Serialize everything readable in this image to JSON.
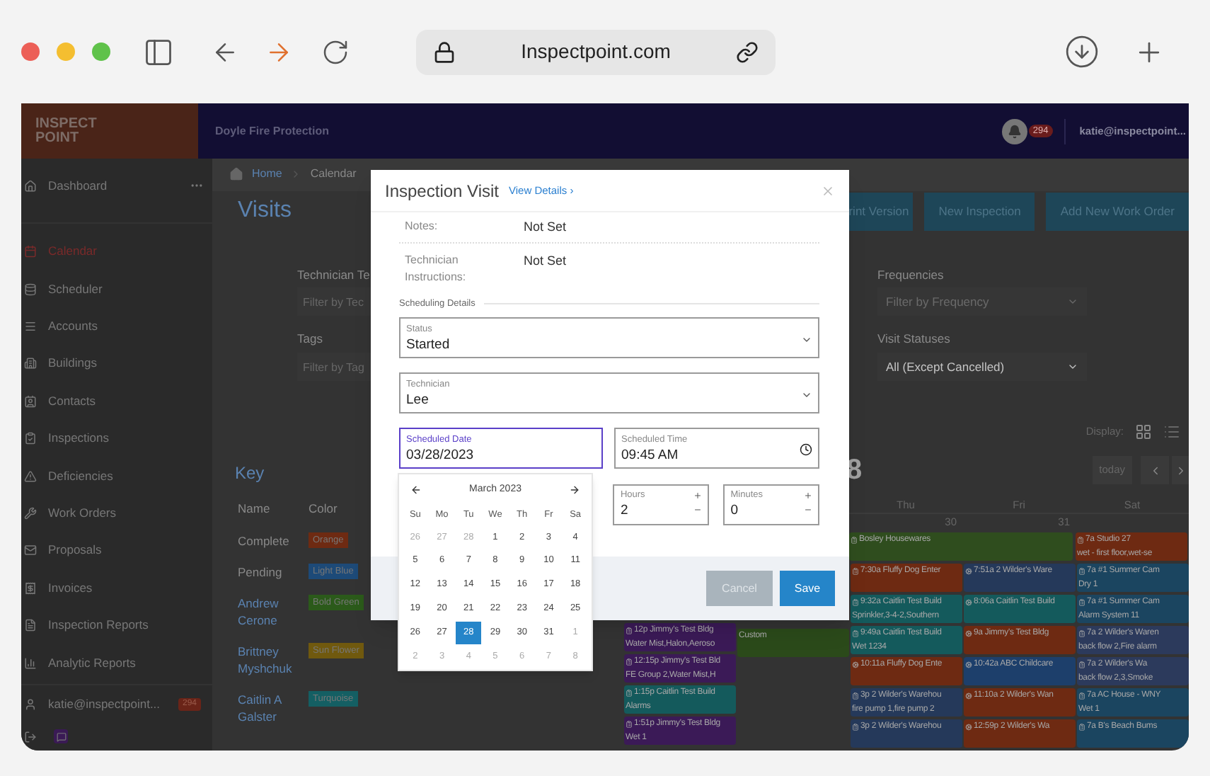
{
  "browser": {
    "url": "Inspectpoint.com"
  },
  "header": {
    "logo": [
      "INSPECT",
      "POINT"
    ],
    "company": "Doyle Fire Protection",
    "notifications": "294",
    "user": "katie@inspectpoint..."
  },
  "sidebar": {
    "items": [
      {
        "label": "Dashboard",
        "selected": false
      },
      {
        "label": "Calendar",
        "selected": true
      },
      {
        "label": "Scheduler",
        "selected": false
      },
      {
        "label": "Accounts",
        "selected": false
      },
      {
        "label": "Buildings",
        "selected": false
      },
      {
        "label": "Contacts",
        "selected": false
      },
      {
        "label": "Inspections",
        "selected": false
      },
      {
        "label": "Deficiencies",
        "selected": false
      },
      {
        "label": "Work Orders",
        "selected": false
      },
      {
        "label": "Proposals",
        "selected": false
      },
      {
        "label": "Invoices",
        "selected": false
      },
      {
        "label": "Inspection Reports",
        "selected": false
      },
      {
        "label": "Analytic Reports",
        "selected": false
      }
    ],
    "user": "katie@inspectpoint...",
    "badge": "294"
  },
  "page": {
    "breadcrumb": [
      "Home",
      "Calendar"
    ],
    "title": "Visits",
    "buttons": [
      "rint Version",
      "New Inspection",
      "Add New Work Order"
    ],
    "filters_left": [
      {
        "label": "Technician Te",
        "placeholder": "Filter by Tec"
      },
      {
        "label": "Tags",
        "placeholder": "Filter by Tag"
      }
    ],
    "filters_right": [
      {
        "label": "Frequencies",
        "placeholder": "Filter by Frequency"
      },
      {
        "label": "Visit Statuses",
        "value": "All (Except Cancelled)"
      }
    ],
    "display_label": "Display:",
    "calendar_title": "8",
    "today": "today"
  },
  "key": {
    "title": "Key",
    "columns": [
      "Name",
      "Color"
    ],
    "rows": [
      {
        "name": "Complete",
        "label": "Orange",
        "color": "#6e2a12",
        "kind": "status"
      },
      {
        "name": "Pending",
        "label": "Light Blue",
        "color": "#1d4a78",
        "kind": "status"
      },
      {
        "name": "Andrew Cerone",
        "label": "Bold Green",
        "color": "#2b5a1a",
        "kind": "technician"
      },
      {
        "name": "Brittney Myshchuk",
        "label": "Sun Flower",
        "color": "#70590e",
        "kind": "technician"
      },
      {
        "name": "Caitlin A Galster",
        "label": "Turquoise",
        "color": "#145f63",
        "kind": "technician"
      }
    ]
  },
  "calendar": {
    "columns": [
      {
        "events": [
          {
            "kind": "inspection",
            "color": "#3b1a57",
            "lines": [
              "12p Jimmy's Test Bldg",
              "Water Mist,Halon,Aeroso"
            ]
          },
          {
            "kind": "inspection",
            "color": "#3b1a57",
            "lines": [
              "12:15p Jimmy's Test Bld",
              "FE Group 2,Water Mist,H"
            ]
          },
          {
            "kind": "inspection",
            "color": "#145a5c",
            "lines": [
              "1:15p Caitlin Test Build",
              "Alarms"
            ]
          },
          {
            "kind": "inspection",
            "color": "#3b1a57",
            "lines": [
              "1:51p Jimmy's Test Bldg",
              "Wet 1"
            ]
          }
        ]
      },
      {
        "events": [
          {
            "kind": "plain",
            "color": "#2b4a1a",
            "lines": [
              "Custom"
            ]
          }
        ]
      },
      {
        "day": "Thu",
        "date": "30",
        "all_day": {
          "kind": "inspection",
          "color": "#2f4d1e",
          "lines": [
            "Bosley Housewares"
          ],
          "span": true
        },
        "events": [
          {
            "kind": "inspection",
            "color": "#6e2a12",
            "lines": [
              "7:30a Fluffy Dog Enter"
            ]
          },
          {
            "kind": "inspection",
            "color": "#145a5c",
            "lines": [
              "9:32a Caitlin Test Build",
              "Sprinkler,3-4-2,Southern"
            ]
          },
          {
            "kind": "inspection",
            "color": "#145a5c",
            "lines": [
              "9:49a Caitlin Test Build",
              "Wet 1234"
            ]
          },
          {
            "kind": "work_order",
            "color": "#6e2a12",
            "lines": [
              "10:11a Fluffy Dog Ente"
            ]
          },
          {
            "kind": "inspection",
            "color": "#25395a",
            "lines": [
              "3p 2 Wilder's Warehou",
              "fire pump 1,fire pump 2"
            ]
          },
          {
            "kind": "inspection",
            "color": "#25395a",
            "lines": [
              "3p 2 Wilder's Warehou"
            ]
          }
        ]
      },
      {
        "day": "Fri",
        "date": "31",
        "events": [
          {
            "kind": "work_order",
            "color": "#25395a",
            "lines": [
              "7:51a 2 Wilder's Ware"
            ]
          },
          {
            "kind": "work_order",
            "color": "#145a5c",
            "lines": [
              "8:06a Caitlin Test Build"
            ]
          },
          {
            "kind": "work_order",
            "color": "#6e2a12",
            "lines": [
              "9a Jimmy's Test Bldg"
            ]
          },
          {
            "kind": "work_order",
            "color": "#1d3f6b",
            "lines": [
              "10:42a ABC Childcare"
            ]
          },
          {
            "kind": "work_order",
            "color": "#6e2a12",
            "lines": [
              "11:10a 2 Wilder's Wan"
            ]
          },
          {
            "kind": "work_order",
            "color": "#6e2a12",
            "lines": [
              "12:59p 2 Wilder's Wa"
            ]
          }
        ]
      },
      {
        "day": "Sat",
        "all_day": {
          "kind": "inspection",
          "color": "#6e2a12",
          "lines": [
            "7a Studio 27",
            "wet - first floor,wet-se"
          ],
          "span": false
        },
        "events": [
          {
            "kind": "inspection",
            "color": "#1b4560",
            "lines": [
              "7a #1 Summer Cam",
              "Dry 1"
            ]
          },
          {
            "kind": "inspection",
            "color": "#1b4560",
            "lines": [
              "7a #1 Summer Cam",
              "Alarm System 11"
            ]
          },
          {
            "kind": "inspection",
            "color": "#2c3a5c",
            "lines": [
              "7a 2 Wilder's Waren",
              "back flow 2,Fire alarm"
            ]
          },
          {
            "kind": "inspection",
            "color": "#2c3a5c",
            "lines": [
              "7a 2 Wilder's Wa",
              "back flow 2,3,Smoke"
            ]
          },
          {
            "kind": "inspection",
            "color": "#1b4560",
            "lines": [
              "7a AC House - WNY",
              "Wet 1"
            ]
          },
          {
            "kind": "inspection",
            "color": "#1b4560",
            "lines": [
              "7a B's Beach Bums"
            ]
          }
        ]
      }
    ]
  },
  "modal": {
    "title": "Inspection Visit",
    "link": "View Details ›",
    "details": [
      {
        "label": "Notes:",
        "value": "Not Set"
      },
      {
        "label": "Technician Instructions:",
        "value": "Not Set"
      }
    ],
    "section": "Scheduling Details",
    "status": {
      "label": "Status",
      "value": "Started"
    },
    "technician": {
      "label": "Technician",
      "value": "Lee"
    },
    "date": {
      "label": "Scheduled Date",
      "value": "03/28/2023",
      "focused": true
    },
    "time": {
      "label": "Scheduled Time",
      "value": "09:45 AM",
      "focused": false
    },
    "hours": {
      "label": "Hours",
      "value": "2"
    },
    "minutes": {
      "label": "Minutes",
      "value": "0"
    },
    "cancel": "Cancel",
    "save": "Save"
  },
  "datepicker": {
    "month": "March 2023",
    "weekdays": [
      "Su",
      "Mo",
      "Tu",
      "We",
      "Th",
      "Fr",
      "Sa"
    ],
    "weeks": [
      [
        {
          "day": "26",
          "muted": true,
          "selected": false
        },
        {
          "day": "27",
          "muted": true,
          "selected": false
        },
        {
          "day": "28",
          "muted": true,
          "selected": false
        },
        {
          "day": "1",
          "muted": false,
          "selected": false
        },
        {
          "day": "2",
          "muted": false,
          "selected": false
        },
        {
          "day": "3",
          "muted": false,
          "selected": false
        },
        {
          "day": "4",
          "muted": false,
          "selected": false
        }
      ],
      [
        {
          "day": "5",
          "muted": false,
          "selected": false
        },
        {
          "day": "6",
          "muted": false,
          "selected": false
        },
        {
          "day": "7",
          "muted": false,
          "selected": false
        },
        {
          "day": "8",
          "muted": false,
          "selected": false
        },
        {
          "day": "9",
          "muted": false,
          "selected": false
        },
        {
          "day": "10",
          "muted": false,
          "selected": false
        },
        {
          "day": "11",
          "muted": false,
          "selected": false
        }
      ],
      [
        {
          "day": "12",
          "muted": false,
          "selected": false
        },
        {
          "day": "13",
          "muted": false,
          "selected": false
        },
        {
          "day": "14",
          "muted": false,
          "selected": false
        },
        {
          "day": "15",
          "muted": false,
          "selected": false
        },
        {
          "day": "16",
          "muted": false,
          "selected": false
        },
        {
          "day": "17",
          "muted": false,
          "selected": false
        },
        {
          "day": "18",
          "muted": false,
          "selected": false
        }
      ],
      [
        {
          "day": "19",
          "muted": false,
          "selected": false
        },
        {
          "day": "20",
          "muted": false,
          "selected": false
        },
        {
          "day": "21",
          "muted": false,
          "selected": false
        },
        {
          "day": "22",
          "muted": false,
          "selected": false
        },
        {
          "day": "23",
          "muted": false,
          "selected": false
        },
        {
          "day": "24",
          "muted": false,
          "selected": false
        },
        {
          "day": "25",
          "muted": false,
          "selected": false
        }
      ],
      [
        {
          "day": "26",
          "muted": false,
          "selected": false
        },
        {
          "day": "27",
          "muted": false,
          "selected": false
        },
        {
          "day": "28",
          "muted": false,
          "selected": true
        },
        {
          "day": "29",
          "muted": false,
          "selected": false
        },
        {
          "day": "30",
          "muted": false,
          "selected": false
        },
        {
          "day": "31",
          "muted": false,
          "selected": false
        },
        {
          "day": "1",
          "muted": true,
          "selected": false
        }
      ],
      [
        {
          "day": "2",
          "muted": true,
          "selected": false
        },
        {
          "day": "3",
          "muted": true,
          "selected": false
        },
        {
          "day": "4",
          "muted": true,
          "selected": false
        },
        {
          "day": "5",
          "muted": true,
          "selected": false
        },
        {
          "day": "6",
          "muted": true,
          "selected": false
        },
        {
          "day": "7",
          "muted": true,
          "selected": false
        },
        {
          "day": "8",
          "muted": true,
          "selected": false
        }
      ]
    ]
  }
}
